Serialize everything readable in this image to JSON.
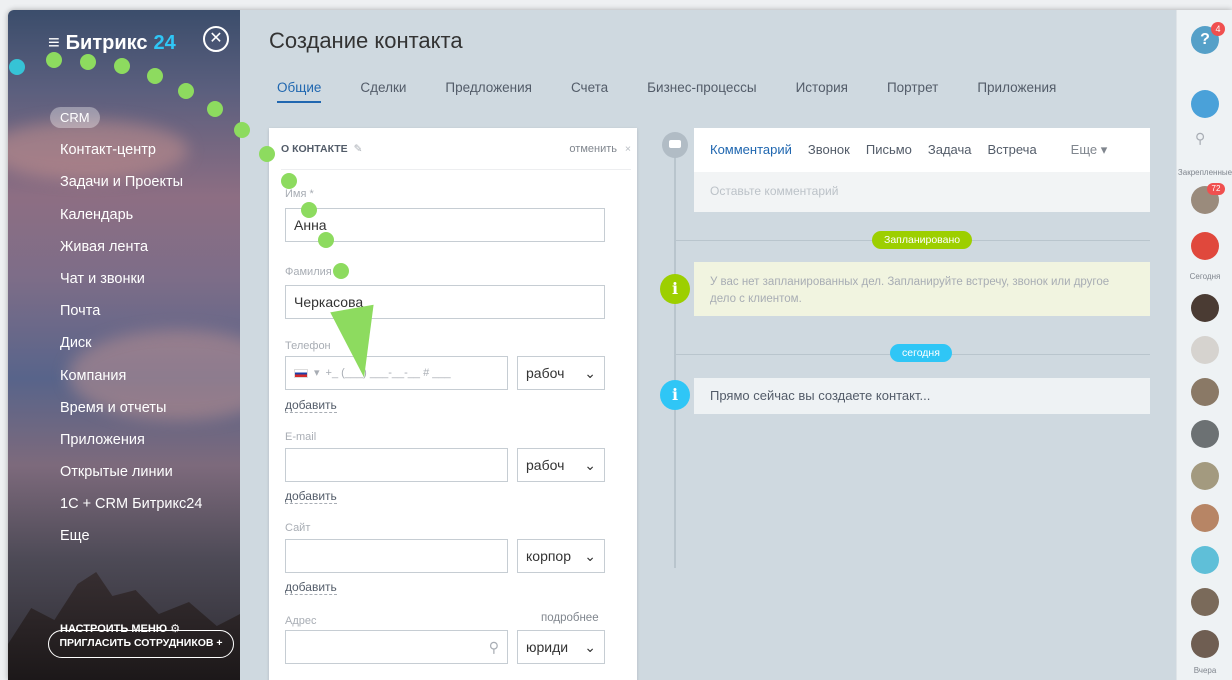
{
  "brand": {
    "name": "Битрикс",
    "num": "24"
  },
  "sidebar": {
    "items": [
      "CRM",
      "Контакт-центр",
      "Задачи и Проекты",
      "Календарь",
      "Живая лента",
      "Чат и звонки",
      "Почта",
      "Диск",
      "Компания",
      "Время и отчеты",
      "Приложения",
      "Открытые линии",
      "1С + CRM Битрикс24",
      "Еще"
    ],
    "setup": "НАСТРОИТЬ МЕНЮ",
    "invite": "ПРИГЛАСИТЬ СОТРУДНИКОВ +"
  },
  "page": {
    "title": "Создание контакта"
  },
  "tabs": [
    "Общие",
    "Сделки",
    "Предложения",
    "Счета",
    "Бизнес-процессы",
    "История",
    "Портрет",
    "Приложения"
  ],
  "form": {
    "section": "О КОНТАКТЕ",
    "cancel": "отменить",
    "name_label": "Имя *",
    "name_value": "Анна",
    "last_label": "Фамилия",
    "last_value": "Черкасова",
    "phone_label": "Телефон",
    "phone_mask": "+_ (___) ___-__-__  #  ___",
    "phone_type": "рабоч",
    "add": "добавить",
    "email_label": "E-mail",
    "email_type": "рабоч",
    "site_label": "Сайт",
    "site_type": "корпор",
    "address_label": "Адрес",
    "address_more": "подробнее",
    "address_type": "юриди"
  },
  "timeline": {
    "tabs": [
      "Комментарий",
      "Звонок",
      "Письмо",
      "Задача",
      "Встреча",
      "Еще"
    ],
    "comment_placeholder": "Оставьте комментарий",
    "planned": "Запланировано",
    "planned_text": "У вас нет запланированных дел. Запланируйте встречу, звонок или другое дело с клиентом.",
    "today": "сегодня",
    "today_text": "Прямо сейчас вы создаете контакт..."
  },
  "rightbar": {
    "help_badge": "4",
    "pinned": "Закрепленные",
    "count": "72",
    "today": "Сегодня",
    "yesterday": "Вчера"
  },
  "colors": {
    "accent": "#2067b0",
    "green": "#8ddb5f",
    "teal": "#36c3d6",
    "timeline_green": "#9dcf00",
    "timeline_blue": "#2fc6f6"
  }
}
